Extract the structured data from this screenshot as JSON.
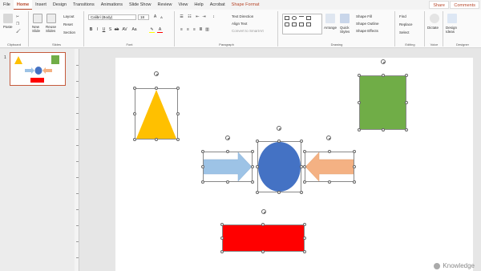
{
  "menu": {
    "tabs": [
      "File",
      "Home",
      "Insert",
      "Design",
      "Transitions",
      "Animations",
      "Slide Show",
      "Review",
      "View",
      "Help",
      "Acrobat",
      "Shape Format"
    ],
    "active_tab": "Home",
    "share": "Share",
    "comments": "Comments"
  },
  "ribbon": {
    "clipboard": {
      "paste": "Paste",
      "label": "Clipboard"
    },
    "slides": {
      "new_slide": "New Slide",
      "reuse_slides": "Reuse Slides",
      "layout": "Layout",
      "reset": "Reset",
      "section": "Section",
      "label": "Slides"
    },
    "font": {
      "font_name": "Calibri (Body)",
      "font_size": "18",
      "label": "Font"
    },
    "paragraph": {
      "text_direction": "Text Direction",
      "align_text": "Align Text",
      "smartart": "Convert to SmartArt",
      "label": "Paragraph"
    },
    "drawing": {
      "arrange": "Arrange",
      "quick_styles": "Quick Styles",
      "shape_fill": "Shape Fill",
      "shape_outline": "Shape Outline",
      "shape_effects": "Shape Effects",
      "label": "Drawing"
    },
    "editing": {
      "find": "Find",
      "replace": "Replace",
      "select": "Select",
      "label": "Editing"
    },
    "voice": {
      "dictate": "Dictate",
      "label": "Voice"
    },
    "designer": {
      "design_ideas": "Design Ideas",
      "label": "Designer"
    }
  },
  "thumbnails": {
    "slide_number": "1"
  },
  "watermark": {
    "text": "Knowledge"
  },
  "colors": {
    "triangle": "#ffc000",
    "square": "#70ad47",
    "circle": "#4472c4",
    "left_arrow": "#f4b183",
    "right_arrow": "#9dc3e6",
    "rectangle": "#ff0000",
    "accent": "#b7472a"
  }
}
